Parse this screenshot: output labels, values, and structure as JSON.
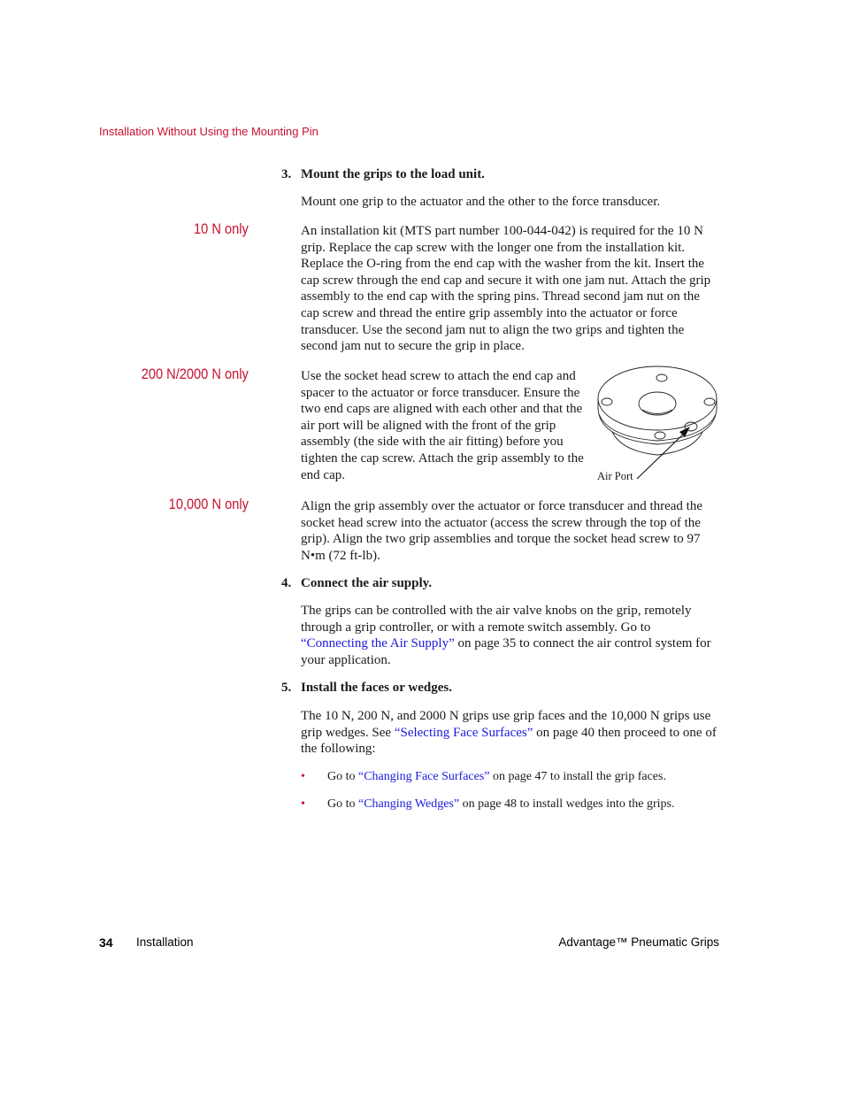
{
  "header": {
    "running_head": "Installation Without Using the Mounting Pin"
  },
  "steps": [
    {
      "number": "3.",
      "title": "Mount the grips to the load unit.",
      "intro": "Mount one grip to the actuator and the other to the force transducer.",
      "variants": [
        {
          "label": "10 N only",
          "text": "An installation kit (MTS part number 100-044-042) is required for the 10 N grip. Replace the cap screw with the longer one from the installation kit. Replace the O-ring from the end cap with the washer from the kit. Insert the cap screw through the end cap and secure it with one jam nut. Attach the grip assembly to the end cap with the spring pins. Thread second jam nut on the cap screw and thread the entire grip assembly into the actuator or force transducer. Use the second jam nut to align the two grips and tighten the second jam nut to secure the grip in place."
        },
        {
          "label": "200 N/2000 N only",
          "text": "Use the socket head screw to attach the end cap and spacer to the actuator or force transducer. Ensure the two end caps are aligned with each other and that the air port will be aligned with the front of the grip assembly (the side with the air fitting) before you tighten the cap screw. Attach the grip assembly to the end cap."
        },
        {
          "label": "10,000 N only",
          "text": "Align the grip assembly over the actuator or force transducer and thread the socket head screw into the actuator (access the screw through the top of the grip). Align the two grip assemblies and torque the socket head screw to 97 N•m (72 ft-lb)."
        }
      ]
    },
    {
      "number": "4.",
      "title": "Connect the air supply.",
      "body_before": "The grips can be controlled with the air valve knobs on the grip, remotely through a grip controller, or with a remote switch assembly. Go to ",
      "link": "“Connecting the Air Supply”",
      "body_after": " on page 35 to connect the air control system for your application."
    },
    {
      "number": "5.",
      "title": "Install the faces or wedges.",
      "body_before": "The 10 N, 200 N, and 2000 N grips use grip faces and the 10,000 N grips use grip wedges. See ",
      "link": "“Selecting Face Surfaces”",
      "body_after": " on page 40 then proceed to one of the following:",
      "bullets": [
        {
          "prefix": "Go to ",
          "link": "“Changing Face Surfaces”",
          "suffix": " on page 47 to install the grip faces."
        },
        {
          "prefix": "Go to ",
          "link": "“Changing Wedges”",
          "suffix": " on page 48 to install wedges into the grips."
        }
      ]
    }
  ],
  "figure": {
    "caption": "Air Port",
    "icon": "end-cap-diagram"
  },
  "footer": {
    "page_number": "34",
    "section": "Installation",
    "title": "Advantage™ Pneumatic Grips"
  }
}
